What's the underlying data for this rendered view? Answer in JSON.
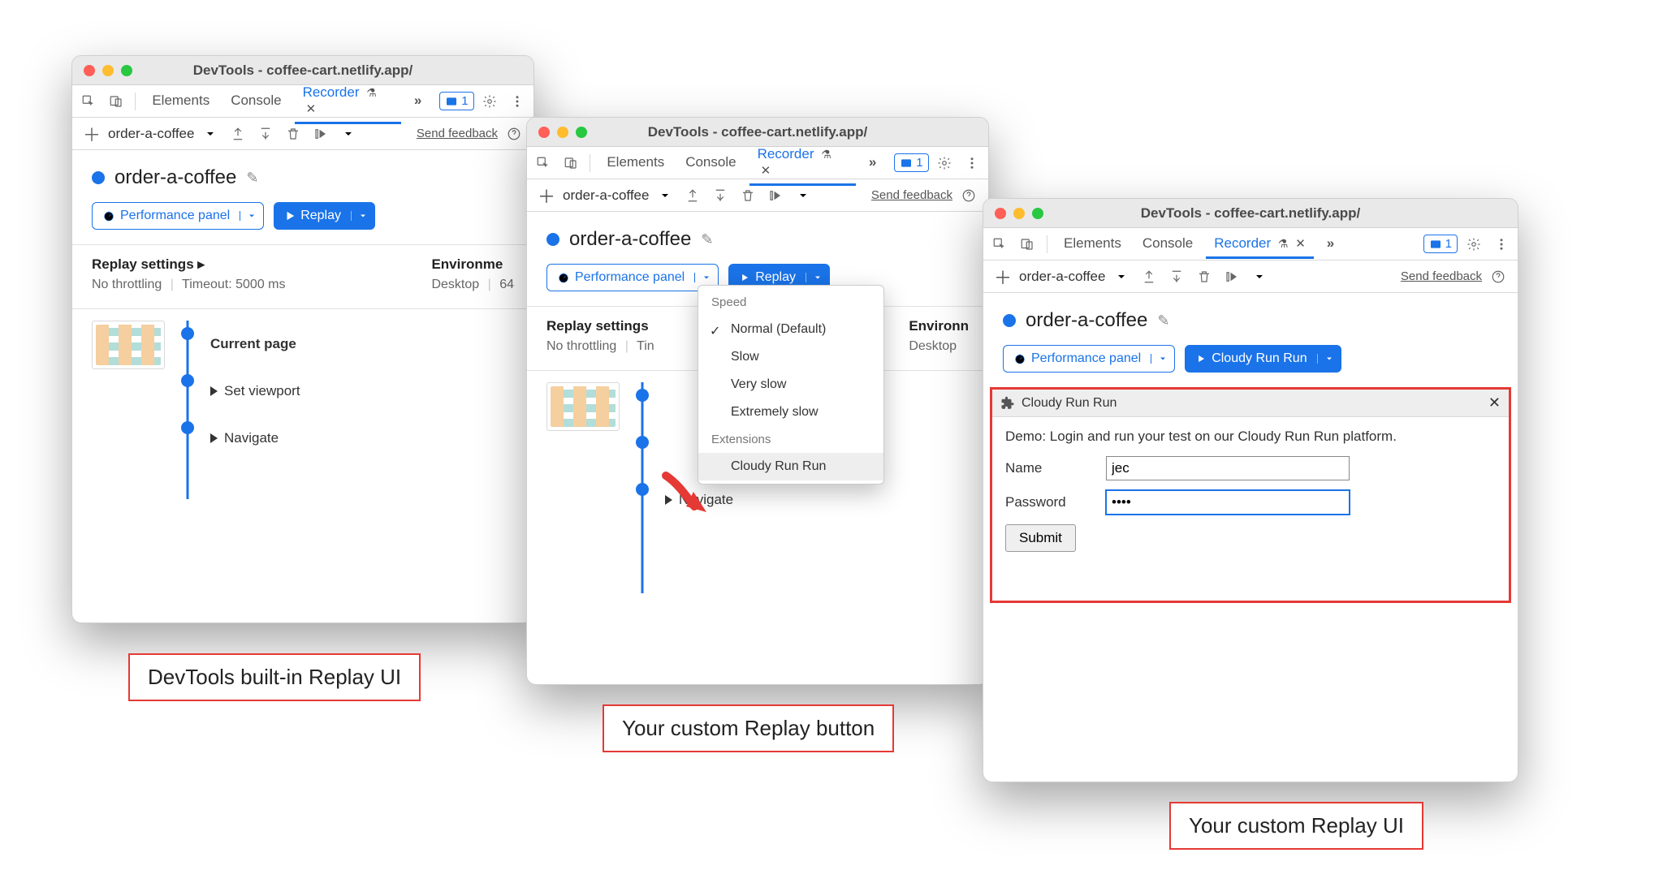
{
  "windowTitle": "DevTools - coffee-cart.netlify.app/",
  "tabs": {
    "elements": "Elements",
    "console": "Console",
    "recorder": "Recorder"
  },
  "issuesBadge": "1",
  "subrow": {
    "recordingName": "order-a-coffee",
    "sendFeedback": "Send feedback"
  },
  "recorder": {
    "title": "order-a-coffee",
    "perfPanel": "Performance panel",
    "replay": "Replay",
    "customReplay": "Cloudy Run Run",
    "settings": {
      "header": "Replay settings",
      "noThrottling": "No throttling",
      "timeout": "Timeout: 5000 ms",
      "envHeader": "Environment",
      "envTrunc": "Environme",
      "envTrunc2": "Environn",
      "envVal": "Desktop",
      "envDetail": "64"
    },
    "steps": {
      "current": "Current page",
      "viewport": "Set viewport",
      "navigate": "Navigate"
    }
  },
  "dropdown": {
    "speed": "Speed",
    "items": {
      "normal": "Normal (Default)",
      "slow": "Slow",
      "verySlow": "Very slow",
      "extremelySlow": "Extremely slow"
    },
    "extensionsHeader": "Extensions",
    "extItem": "Cloudy Run Run"
  },
  "ext": {
    "title": "Cloudy Run Run",
    "desc": "Demo: Login and run your test on our Cloudy Run Run platform.",
    "nameLabel": "Name",
    "nameValue": "jec",
    "passwordLabel": "Password",
    "passwordValue": "••••",
    "submit": "Submit"
  },
  "captions": {
    "c1": "DevTools built-in Replay UI",
    "c2": "Your custom Replay button",
    "c3": "Your custom Replay UI"
  }
}
